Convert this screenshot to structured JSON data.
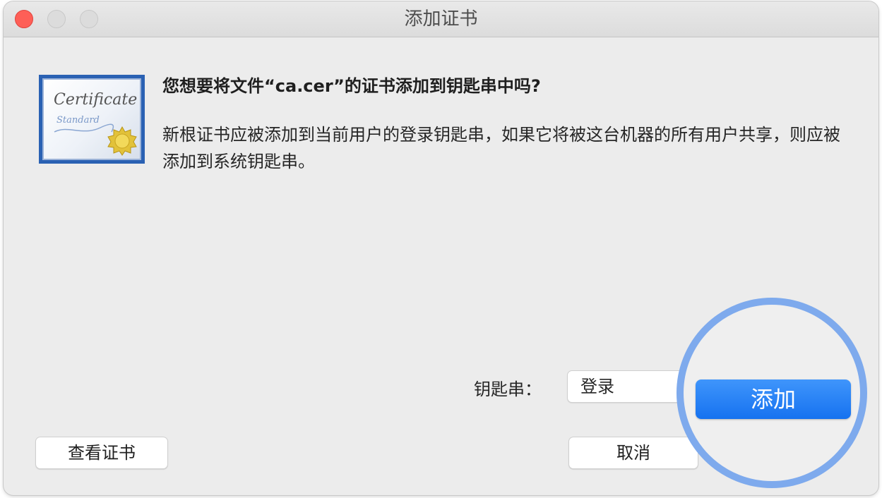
{
  "window": {
    "title": "添加证书"
  },
  "icon": {
    "certificate_word": "Certificate",
    "certificate_sub": "Standard"
  },
  "dialog": {
    "question": "您想要将文件“ca.cer”的证书添加到钥匙串中吗?",
    "message": "新根证书应被添加到当前用户的登录钥匙串，如果它将被这台机器的所有用户共享，则应被添加到系统钥匙串。"
  },
  "keychain": {
    "label": "钥匙串：",
    "selected": "登录"
  },
  "buttons": {
    "view_cert": "查看证书",
    "cancel": "取消",
    "add": "添加"
  },
  "colors": {
    "accent": "#1672f0",
    "highlight_ring": "#7eaaed",
    "close": "#fe5f57"
  }
}
